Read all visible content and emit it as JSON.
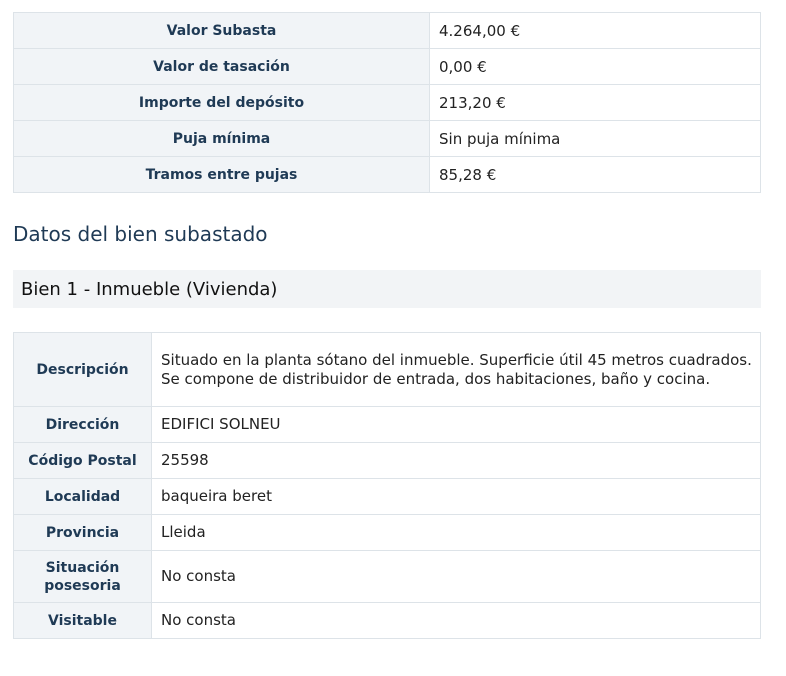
{
  "auction": {
    "rows": [
      {
        "label": "Valor Subasta",
        "value": "4.264,00 €"
      },
      {
        "label": "Valor de tasación",
        "value": "0,00 €"
      },
      {
        "label": "Importe del depósito",
        "value": "213,20 €"
      },
      {
        "label": "Puja mínima",
        "value": "Sin puja mínima"
      },
      {
        "label": "Tramos entre pujas",
        "value": "85,28 €"
      }
    ]
  },
  "section": {
    "title": "Datos del bien subastado"
  },
  "item": {
    "header": "Bien 1 - Inmueble (Vivienda)",
    "rows": [
      {
        "label": "Descripción",
        "value": "Situado en la planta sótano del inmueble. Superficie útil 45 metros cuadrados. Se compone de distribuidor de entrada, dos habitaciones, baño y cocina."
      },
      {
        "label": "Dirección",
        "value": "EDIFICI SOLNEU"
      },
      {
        "label": "Código Postal",
        "value": "25598"
      },
      {
        "label": "Localidad",
        "value": "baqueira beret"
      },
      {
        "label": "Provincia",
        "value": "Lleida"
      },
      {
        "label": "Situación posesoria",
        "value": "No consta"
      },
      {
        "label": "Visitable",
        "value": "No consta"
      }
    ]
  }
}
